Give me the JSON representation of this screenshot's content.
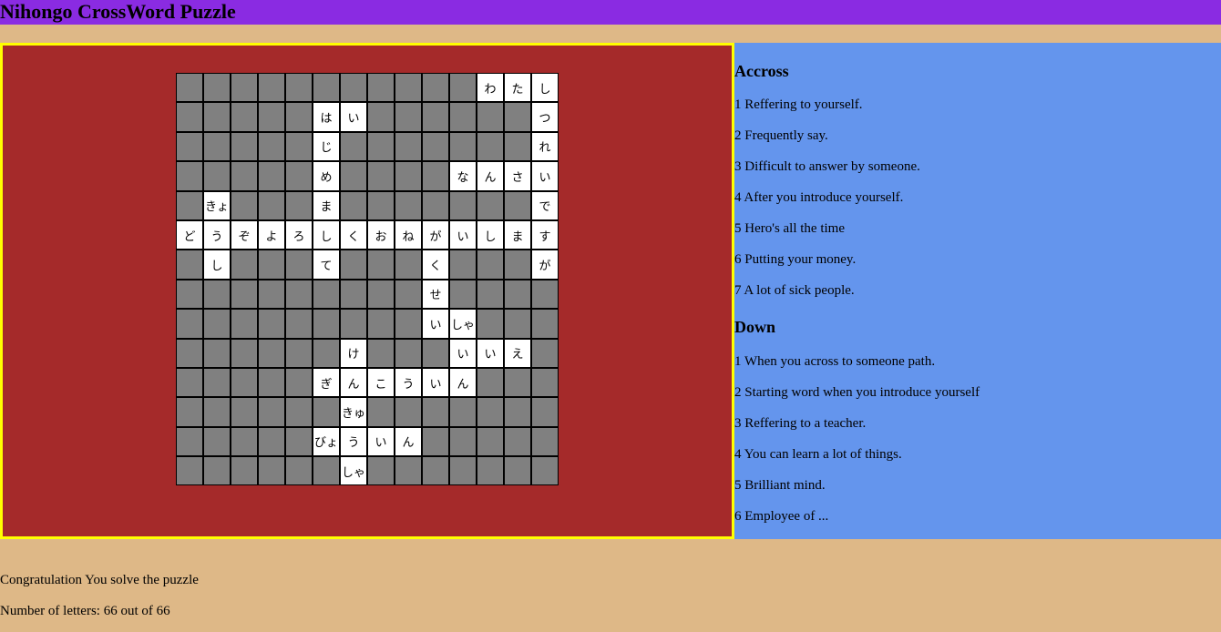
{
  "header": {
    "title": "Nihongo CrossWord Puzzle",
    "background": "#8a2be2"
  },
  "colors": {
    "page_bg": "#deb887",
    "puzzle_bg": "#a52a2a",
    "puzzle_border": "#ffff00",
    "clues_bg": "#6495ed",
    "blocked_cell": "#808080",
    "open_cell": "#ffffff"
  },
  "grid": {
    "rows": [
      [
        "#",
        "#",
        "#",
        "#",
        "#",
        "#",
        "#",
        "#",
        "#",
        "#",
        "#",
        "わ",
        "た",
        "し"
      ],
      [
        "#",
        "#",
        "#",
        "#",
        "#",
        "は",
        "い",
        "#",
        "#",
        "#",
        "#",
        "#",
        "#",
        "つ"
      ],
      [
        "#",
        "#",
        "#",
        "#",
        "#",
        "じ",
        "#",
        "#",
        "#",
        "#",
        "#",
        "#",
        "#",
        "れ"
      ],
      [
        "#",
        "#",
        "#",
        "#",
        "#",
        "め",
        "#",
        "#",
        "#",
        "#",
        "な",
        "ん",
        "さ",
        "い"
      ],
      [
        "#",
        "きょ",
        "#",
        "#",
        "#",
        "ま",
        "#",
        "#",
        "#",
        "#",
        "#",
        "#",
        "#",
        "で"
      ],
      [
        "ど",
        "う",
        "ぞ",
        "よ",
        "ろ",
        "し",
        "く",
        "お",
        "ね",
        "が",
        "い",
        "し",
        "ま",
        "す"
      ],
      [
        "#",
        "し",
        "#",
        "#",
        "#",
        "て",
        "#",
        "#",
        "#",
        "く",
        "#",
        "#",
        "#",
        "が"
      ],
      [
        "#",
        "#",
        "#",
        "#",
        "#",
        "#",
        "#",
        "#",
        "#",
        "せ",
        "#",
        "#",
        "#",
        "#"
      ],
      [
        "#",
        "#",
        "#",
        "#",
        "#",
        "#",
        "#",
        "#",
        "#",
        "い",
        "しゃ",
        "#",
        "#",
        "#"
      ],
      [
        "#",
        "#",
        "#",
        "#",
        "#",
        "#",
        "け",
        "#",
        "#",
        "#",
        "い",
        "い",
        "え",
        "#"
      ],
      [
        "#",
        "#",
        "#",
        "#",
        "#",
        "ぎ",
        "ん",
        "こ",
        "う",
        "い",
        "ん",
        "#",
        "#",
        "#"
      ],
      [
        "#",
        "#",
        "#",
        "#",
        "#",
        "#",
        "きゅ",
        "#",
        "#",
        "#",
        "#",
        "#",
        "#",
        "#"
      ],
      [
        "#",
        "#",
        "#",
        "#",
        "#",
        "びょ",
        "う",
        "い",
        "ん",
        "#",
        "#",
        "#",
        "#",
        "#"
      ],
      [
        "#",
        "#",
        "#",
        "#",
        "#",
        "#",
        "しゃ",
        "#",
        "#",
        "#",
        "#",
        "#",
        "#",
        "#"
      ]
    ]
  },
  "clues": {
    "across_heading": "Accross",
    "across": [
      "1 Reffering to yourself.",
      "2 Frequently say.",
      "3 Difficult to answer by someone.",
      "4 After you introduce yourself.",
      "5 Hero's all the time",
      "6 Putting your money.",
      "7 A lot of sick people."
    ],
    "down_heading": "Down",
    "down": [
      "1 When you across to someone path.",
      "2 Starting word when you introduce yourself",
      "3 Reffering to a teacher.",
      "4 You can learn a lot of things.",
      "5 Brilliant mind.",
      "6 Employee of ..."
    ]
  },
  "status": {
    "message": "Congratulation You solve the puzzle",
    "letter_count": "Number of letters: 66 out of 66"
  }
}
